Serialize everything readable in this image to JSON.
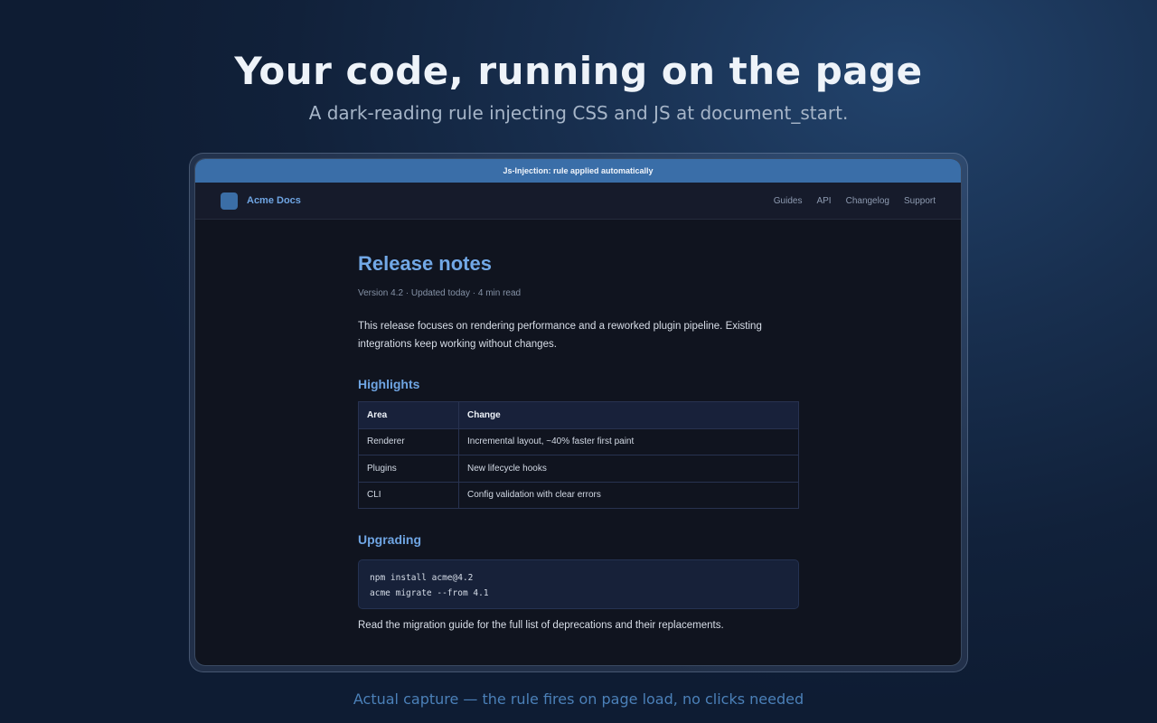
{
  "hero": {
    "title": "Your code, running on the page",
    "subtitle": "A dark-reading rule injecting CSS and JS at document_start."
  },
  "banner": {
    "text": "Js-Injection: rule applied automatically"
  },
  "site_nav": {
    "brand": "Acme Docs",
    "logo_icon": "square-logo-icon",
    "links": [
      "Guides",
      "API",
      "Changelog",
      "Support"
    ]
  },
  "article": {
    "title": "Release notes",
    "meta": "Version 4.2 · Updated today · 4 min read",
    "intro": "This release focuses on rendering performance and a reworked plugin pipeline. Existing integrations keep working without changes.",
    "highlights_heading": "Highlights",
    "table": {
      "headers": [
        "Area",
        "Change"
      ],
      "rows": [
        [
          "Renderer",
          "Incremental layout, ~40% faster first paint"
        ],
        [
          "Plugins",
          "New lifecycle hooks"
        ],
        [
          "CLI",
          "Config validation with clear errors"
        ]
      ]
    },
    "upgrading_heading": "Upgrading",
    "code_lines": [
      "npm install acme@4.2",
      "acme migrate --from 4.1"
    ],
    "footer_note": "Read the migration guide for the full list of deprecations and their replacements."
  },
  "caption": "Actual capture — the rule fires on page load, no clicks needed",
  "colors": {
    "accent": "#6fa5e3",
    "banner": "#3a6ea8",
    "page_bg": "#10141f"
  }
}
